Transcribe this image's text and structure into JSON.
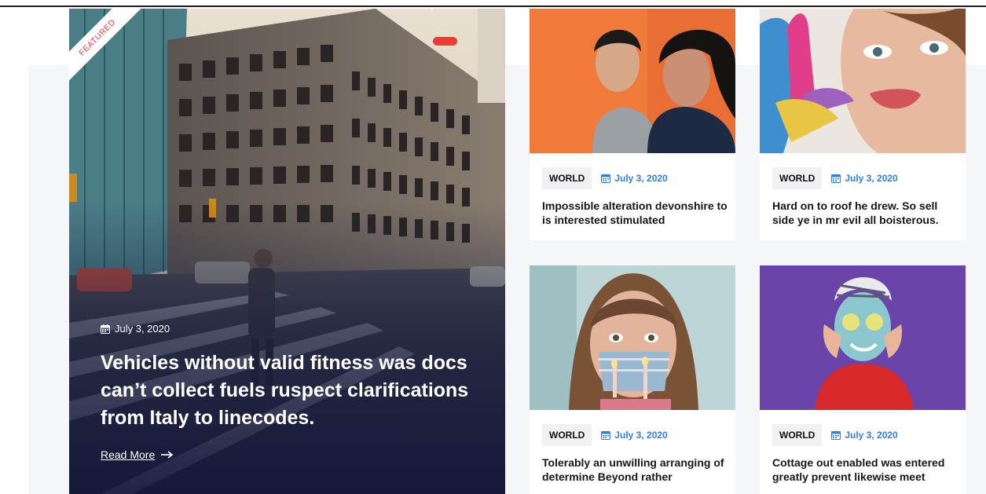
{
  "featured": {
    "badge": "Featured",
    "date": "July 3, 2020",
    "title": "Vehicles without valid fitness was docs can’t collect fuels ruspect clarifications from Italy to linecodes.",
    "read_more": "Read More",
    "read_more_icon": "arrow-right-icon",
    "calendar_icon": "calendar-icon"
  },
  "cards": [
    {
      "category": "WORLD",
      "date": "July 3, 2020",
      "title": "Impossible alteration devonshire to is interested stimulated",
      "image": "couple-portrait"
    },
    {
      "category": "WORLD",
      "date": "July 3, 2020",
      "title": "Hard on to roof he drew. So sell side ye in mr evil all boisterous.",
      "image": "painted-hand-face"
    },
    {
      "category": "WORLD",
      "date": "July 3, 2020",
      "title": "Tolerably an unwilling arranging of determine Beyond rather",
      "image": "girl-with-mask"
    },
    {
      "category": "WORLD",
      "date": "July 3, 2020",
      "title": "Cottage out enabled was entered greatly prevent likewise meet",
      "image": "woman-face-mask"
    }
  ],
  "colors": {
    "accent": "#ef3b36",
    "date_link": "#2f7fe3",
    "background_panel": "#f4f6fa"
  }
}
